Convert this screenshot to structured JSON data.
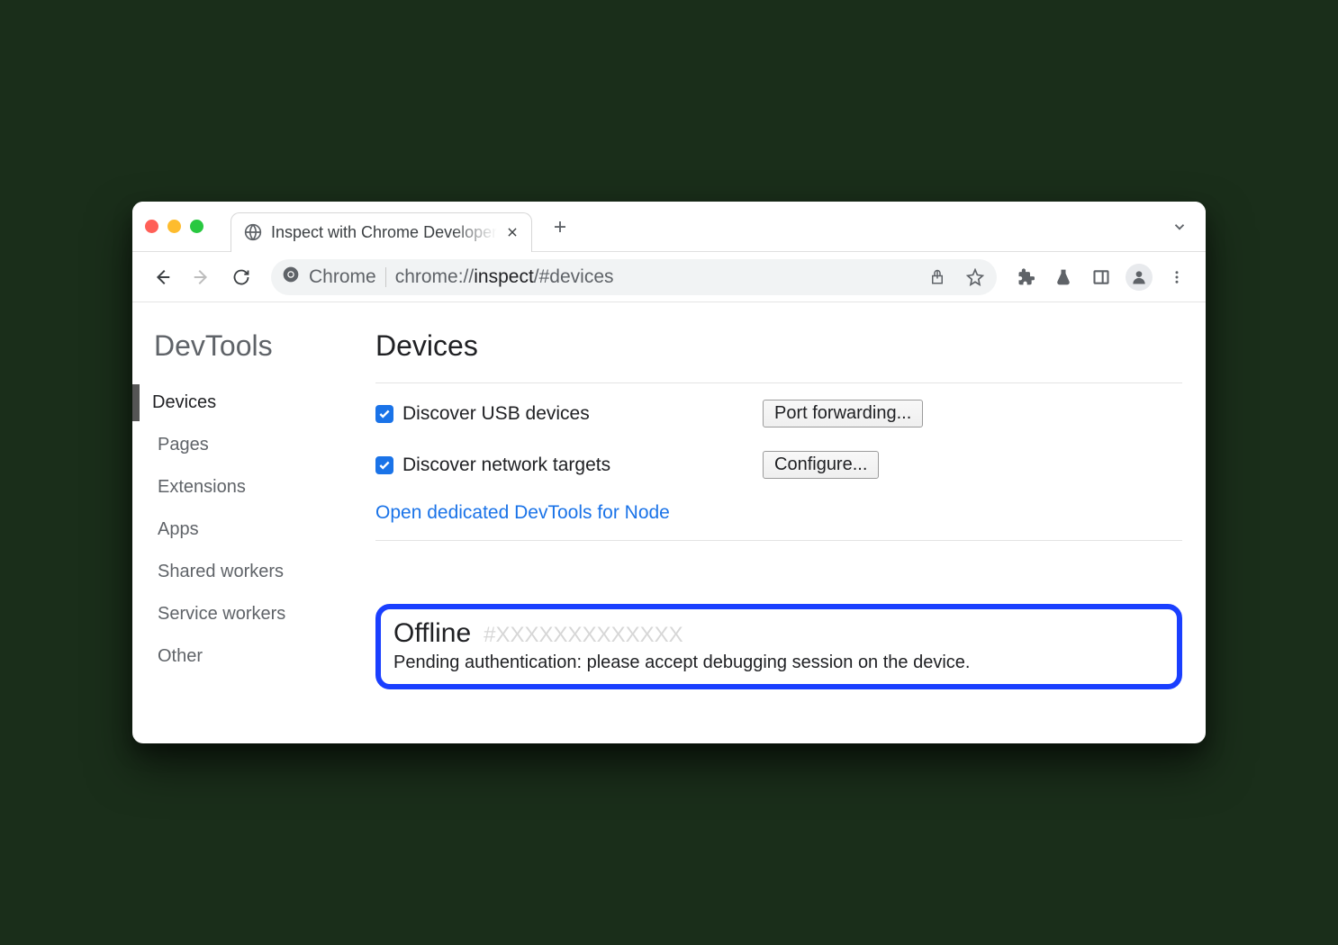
{
  "tab": {
    "title": "Inspect with Chrome Developer"
  },
  "omnibox": {
    "chip_label": "Chrome",
    "url_main": "chrome://",
    "url_bold": "inspect",
    "url_tail": "/#devices"
  },
  "sidebar": {
    "title": "DevTools",
    "items": [
      {
        "label": "Devices",
        "active": true
      },
      {
        "label": "Pages"
      },
      {
        "label": "Extensions"
      },
      {
        "label": "Apps"
      },
      {
        "label": "Shared workers"
      },
      {
        "label": "Service workers"
      },
      {
        "label": "Other"
      }
    ]
  },
  "main": {
    "title": "Devices",
    "discover_usb_label": "Discover USB devices",
    "port_forwarding_button": "Port forwarding...",
    "discover_network_label": "Discover network targets",
    "configure_button": "Configure...",
    "node_link": "Open dedicated DevTools for Node"
  },
  "device": {
    "status": "Offline",
    "hash": "#XXXXXXXXXXXXX",
    "message": "Pending authentication: please accept debugging session on the device."
  }
}
